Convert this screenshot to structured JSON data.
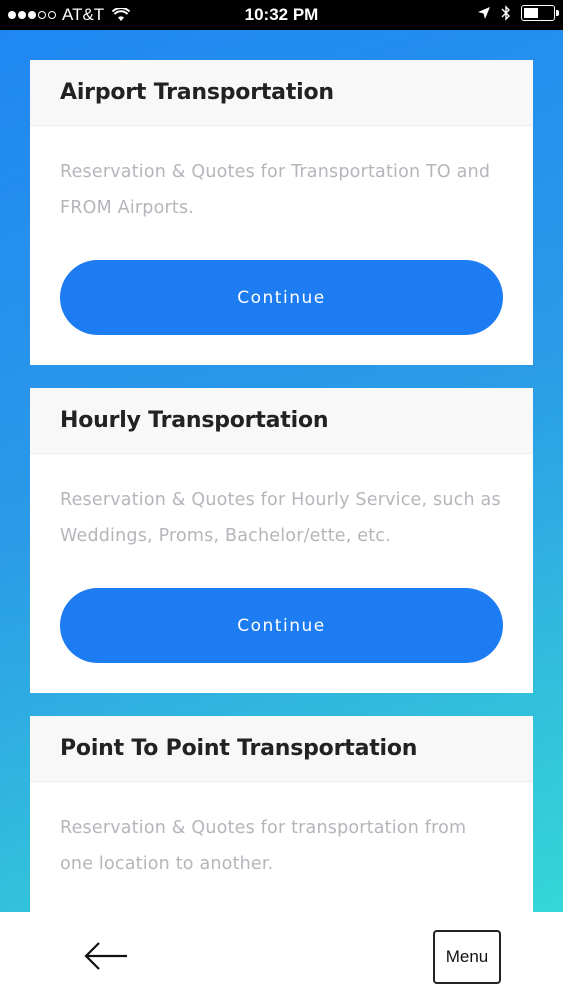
{
  "status_bar": {
    "carrier": "AT&T",
    "time": "10:32 PM"
  },
  "cards": [
    {
      "title": "Airport Transportation",
      "description": "Reservation & Quotes for Transportation TO and FROM Airports.",
      "button_label": "Continue"
    },
    {
      "title": "Hourly Transportation",
      "description": "Reservation & Quotes for Hourly Service, such as Weddings, Proms, Bachelor/ette, etc.",
      "button_label": "Continue"
    },
    {
      "title": "Point To Point Transportation",
      "description": "Reservation & Quotes for transportation from one location to another."
    }
  ],
  "bottom_bar": {
    "back_icon": "left-arrow",
    "menu_label": "Menu"
  },
  "colors": {
    "accent": "#1d7cf2",
    "gradient_start": "#1f86f3",
    "gradient_end": "#36dfd6"
  }
}
